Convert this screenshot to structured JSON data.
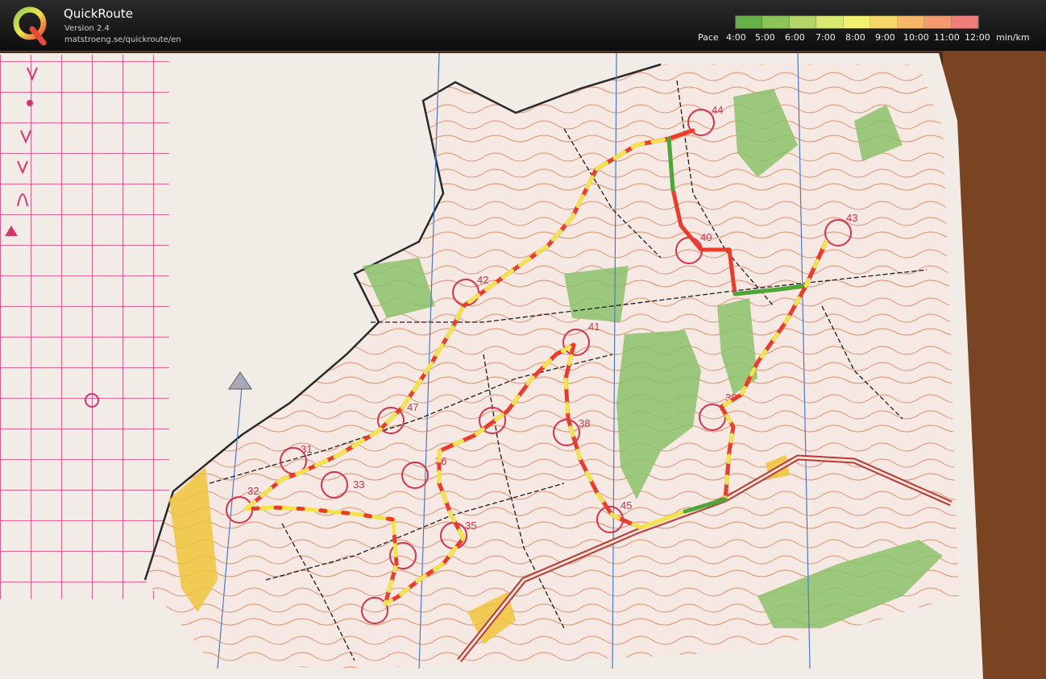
{
  "app": {
    "name": "QuickRoute",
    "version": "Version 2.4",
    "url": "matstroeng.se/quickroute/en",
    "logo_icon": "quickroute-q-logo"
  },
  "pace_legend": {
    "label": "Pace",
    "ticks": [
      "4:00",
      "5:00",
      "6:00",
      "7:00",
      "8:00",
      "9:00",
      "10:00",
      "11:00",
      "12:00"
    ],
    "unit": "min/km",
    "colors": [
      "#66b04a",
      "#8cc45a",
      "#b2d66a",
      "#d8e870",
      "#f2f070",
      "#f6d86a",
      "#f6b868",
      "#f49a70",
      "#f07e78"
    ]
  },
  "map": {
    "controls": [
      "31",
      "32",
      "33",
      "35",
      "36",
      "38",
      "39",
      "40",
      "41",
      "42",
      "43",
      "44",
      "45",
      "47"
    ],
    "route_colors": {
      "fast": "#4aa838",
      "medium": "#f2e44a",
      "slow": "#ee3a2a"
    }
  }
}
